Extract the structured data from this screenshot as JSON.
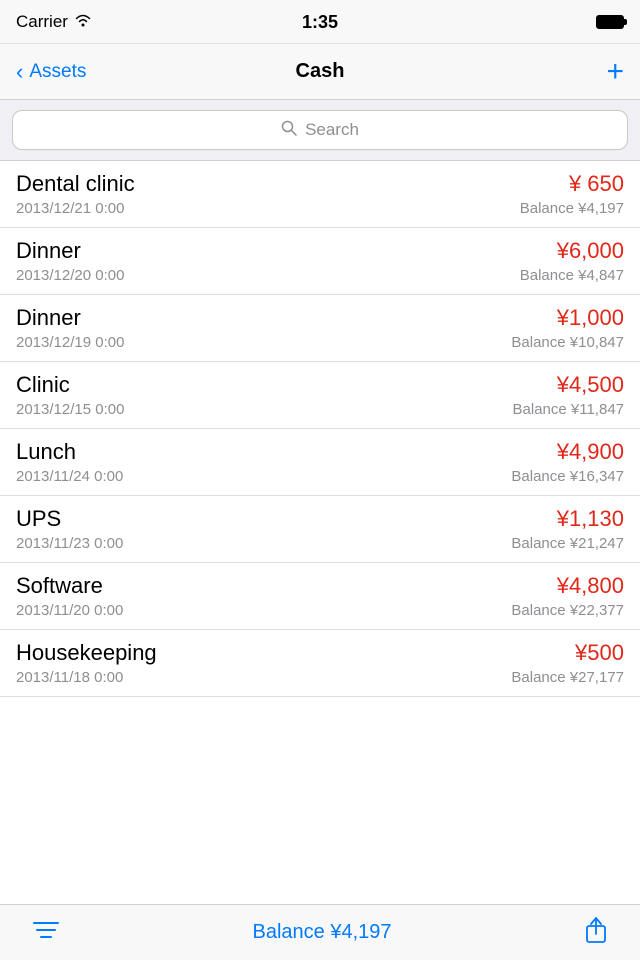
{
  "statusBar": {
    "carrier": "Carrier",
    "time": "1:35"
  },
  "navBar": {
    "backLabel": "Assets",
    "title": "Cash",
    "addLabel": "+"
  },
  "search": {
    "placeholder": "Search"
  },
  "transactions": [
    {
      "name": "Dental clinic",
      "amount": "¥ 650",
      "date": "2013/12/21 0:00",
      "balance": "Balance ¥4,197"
    },
    {
      "name": "Dinner",
      "amount": "¥6,000",
      "date": "2013/12/20 0:00",
      "balance": "Balance ¥4,847"
    },
    {
      "name": "Dinner",
      "amount": "¥1,000",
      "date": "2013/12/19 0:00",
      "balance": "Balance ¥10,847"
    },
    {
      "name": "Clinic",
      "amount": "¥4,500",
      "date": "2013/12/15 0:00",
      "balance": "Balance ¥11,847"
    },
    {
      "name": "Lunch",
      "amount": "¥4,900",
      "date": "2013/11/24 0:00",
      "balance": "Balance ¥16,347"
    },
    {
      "name": "UPS",
      "amount": "¥1,130",
      "date": "2013/11/23 0:00",
      "balance": "Balance ¥21,247"
    },
    {
      "name": "Software",
      "amount": "¥4,800",
      "date": "2013/11/20 0:00",
      "balance": "Balance ¥22,377"
    },
    {
      "name": "Housekeeping",
      "amount": "¥500",
      "date": "2013/11/18 0:00",
      "balance": "Balance ¥27,177"
    }
  ],
  "bottomToolbar": {
    "balanceLabel": "Balance ¥4,197"
  }
}
